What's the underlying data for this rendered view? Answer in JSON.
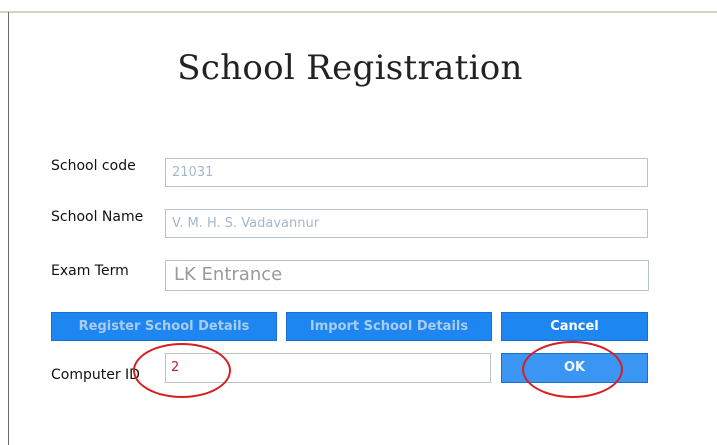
{
  "dialog": {
    "title": "School Registration"
  },
  "form": {
    "school_code": {
      "label": "School code",
      "value": "21031"
    },
    "school_name": {
      "label": "School Name",
      "value": "V. M. H. S. Vadavannur"
    },
    "exam_term": {
      "label": "Exam Term",
      "value": "LK Entrance"
    },
    "computer_id": {
      "label": "Computer ID",
      "value": "2"
    }
  },
  "buttons": {
    "register": "Register School Details",
    "import": "Import School Details",
    "cancel": "Cancel",
    "ok": "OK"
  },
  "colors": {
    "button_blue": "#1e86f0",
    "annotation_red": "#d81f1f"
  }
}
